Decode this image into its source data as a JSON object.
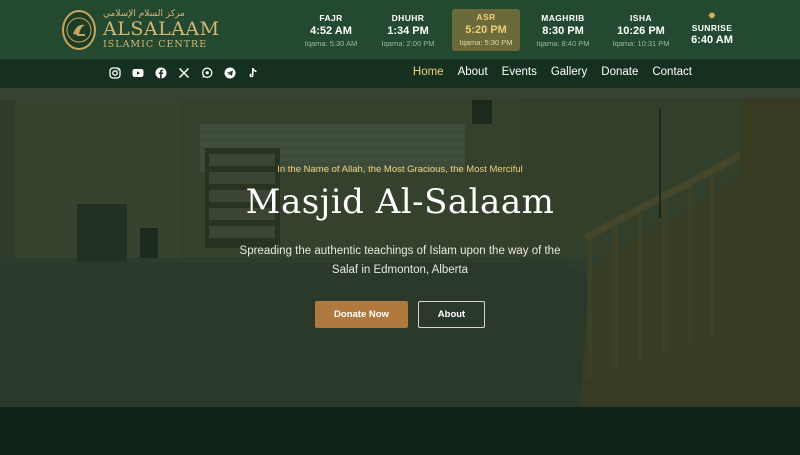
{
  "logo": {
    "arabic": "مركز السلام الإسلامي",
    "name": "ALSALAAM",
    "subtitle": "ISLAMIC CENTRE"
  },
  "prayers": [
    {
      "name": "FAJR",
      "time": "4:52 AM",
      "iqama": "Iqama: 5:30 AM",
      "active": false
    },
    {
      "name": "DHUHR",
      "time": "1:34 PM",
      "iqama": "Iqama: 2:00 PM",
      "active": false
    },
    {
      "name": "ASR",
      "time": "5:20 PM",
      "iqama": "Iqama: 5:30 PM",
      "active": true
    },
    {
      "name": "MAGHRIB",
      "time": "8:30 PM",
      "iqama": "Iqama: 8:40 PM",
      "active": false
    },
    {
      "name": "ISHA",
      "time": "10:26 PM",
      "iqama": "Iqama: 10:31 PM",
      "active": false
    }
  ],
  "sunrise": {
    "icon": "sun-icon",
    "name": "SUNRISE",
    "time": "6:40 AM"
  },
  "socials": [
    "instagram-icon",
    "youtube-icon",
    "facebook-icon",
    "x-icon",
    "whatsapp-icon",
    "telegram-icon",
    "tiktok-icon"
  ],
  "nav": {
    "items": [
      "Home",
      "About",
      "Events",
      "Gallery",
      "Donate",
      "Contact"
    ],
    "active": "Home"
  },
  "hero": {
    "tagline": "In the Name of Allah, the Most Gracious, the Most Merciful",
    "title": "Masjid Al-Salaam",
    "description": "Spreading the authentic teachings of Islam upon the way of the Salaf in Edmonton, Alberta",
    "donate_label": "Donate Now",
    "about_label": "About"
  },
  "colors": {
    "header_bg": "#234a30",
    "nav_bg": "#15301f",
    "accent_gold": "#f0cf7a",
    "donate_button": "#b07a3e",
    "page_bg": "#0f2417"
  }
}
